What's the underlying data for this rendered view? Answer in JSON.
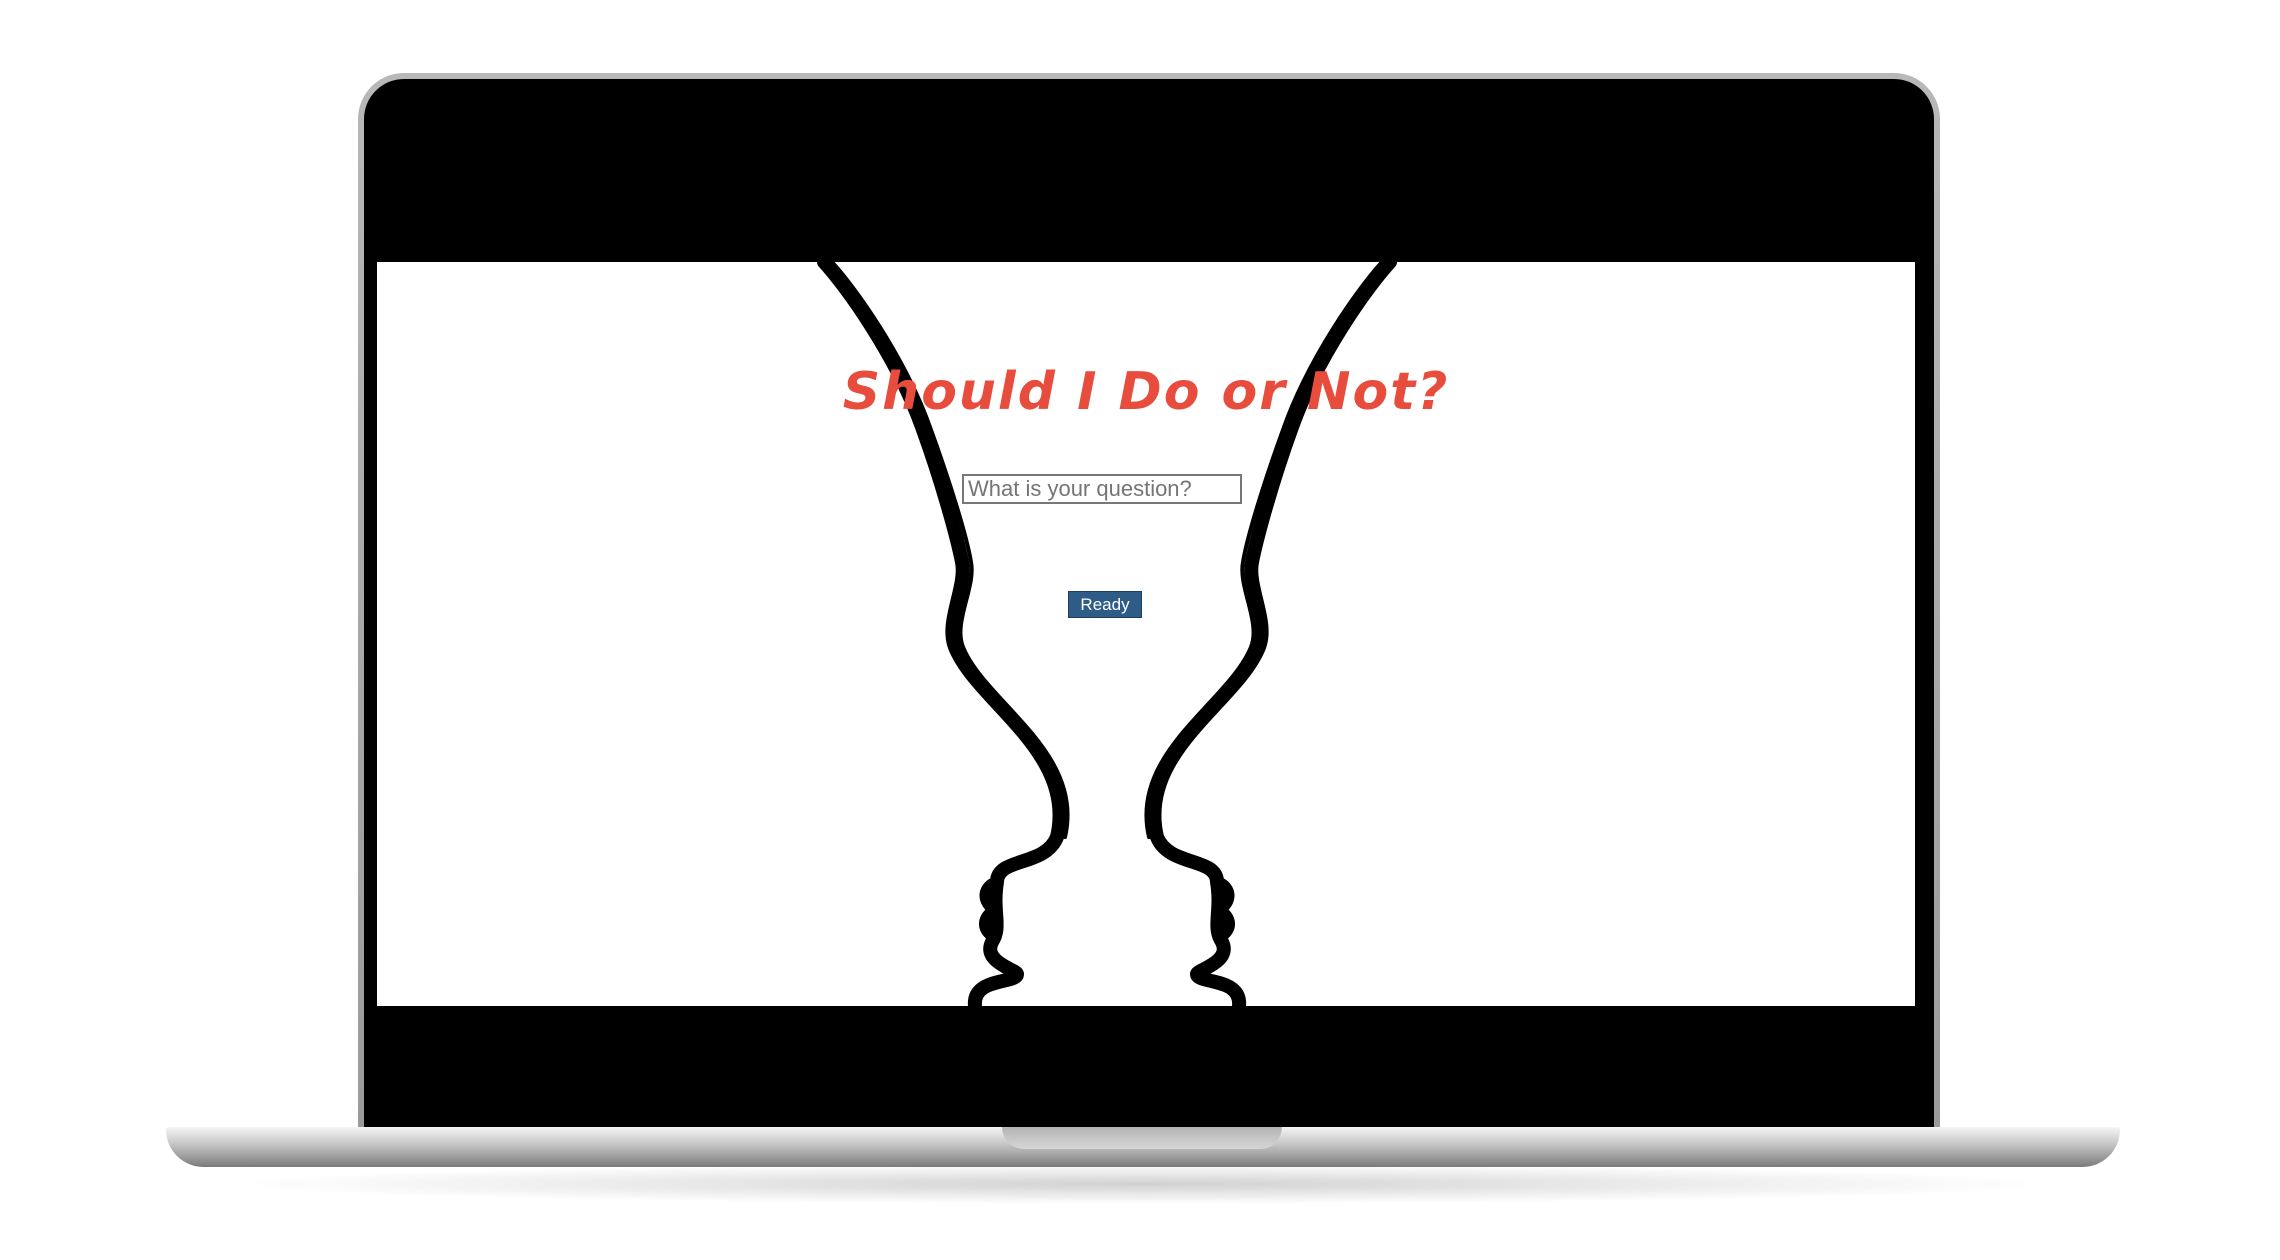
{
  "app": {
    "title": "Should I Do or Not?"
  },
  "question": {
    "value": "",
    "placeholder": "What is your question?"
  },
  "actions": {
    "ready_label": "Ready"
  },
  "colors": {
    "title": "#e74c3c",
    "button_bg": "#2e5c87",
    "button_text": "#ffffff",
    "bezel": "#000000",
    "screen_bg": "#ffffff",
    "vase_outline": "#000000"
  },
  "illustration": {
    "icon": "rubin-vase-faces-outline"
  }
}
